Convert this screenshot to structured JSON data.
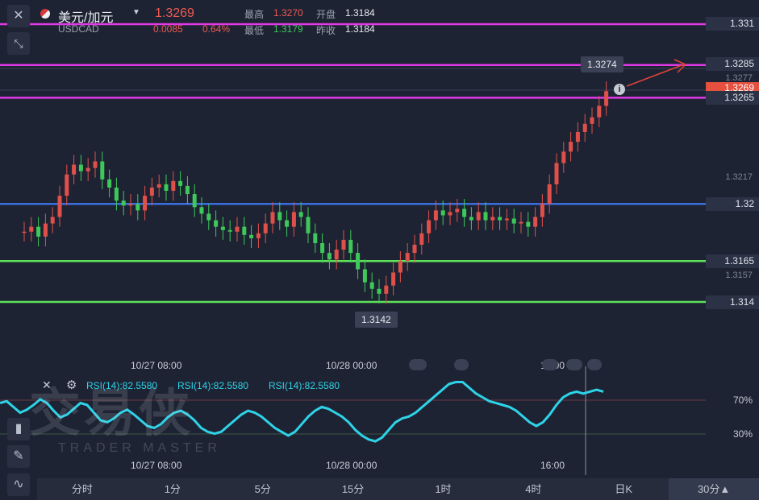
{
  "header": {
    "pair": "美元/加元",
    "code": "USDCAD",
    "price": "1.3269",
    "change": "0.0085",
    "change_pct": "0.64%",
    "high_label": "最高",
    "high": "1.3270",
    "low_label": "最低",
    "low": "1.3179",
    "open_label": "开盘",
    "open": "1.3184",
    "prev_label": "昨收",
    "prev": "1.3184"
  },
  "price_lines": [
    {
      "label": "1.331",
      "value": 1.331,
      "color": "#e13ae6"
    },
    {
      "label": "1.3285",
      "value": 1.3285,
      "color": "#e13ae6"
    },
    {
      "label": "1.3265",
      "value": 1.3265,
      "color": "#e13ae6"
    },
    {
      "label": "1.32",
      "value": 1.32,
      "color": "#3a6fe0"
    },
    {
      "label": "1.3165",
      "value": 1.3165,
      "color": "#5ee25a"
    },
    {
      "label": "1.314",
      "value": 1.314,
      "color": "#5ee25a"
    }
  ],
  "current_price_tag": "1.3269",
  "axis_labels": [
    "1.3277",
    "1.3217",
    "1.3157"
  ],
  "callouts": {
    "high": "1.3274",
    "low": "1.3142"
  },
  "time_labels_top": [
    "10/27 08:00",
    "10/28 00:00",
    "16:00"
  ],
  "time_labels_bottom": [
    "10/27 08:00",
    "10/28 00:00",
    "16:00"
  ],
  "rsi": {
    "labels": [
      "RSI(14):82.5580",
      "RSI(14):82.5580",
      "RSI(14):82.5580"
    ],
    "level_70": "70%",
    "level_30": "30%",
    "values": [
      70,
      72,
      66,
      60,
      63,
      68,
      74,
      70,
      62,
      55,
      58,
      64,
      70,
      68,
      60,
      52,
      50,
      54,
      60,
      63,
      58,
      52,
      46,
      44,
      48,
      55,
      60,
      62,
      58,
      52,
      44,
      40,
      38,
      40,
      46,
      52,
      58,
      62,
      60,
      56,
      50,
      44,
      40,
      36,
      40,
      48,
      56,
      62,
      66,
      64,
      60,
      56,
      50,
      42,
      36,
      32,
      30,
      34,
      42,
      50,
      54,
      56,
      60,
      66,
      72,
      78,
      84,
      90,
      92,
      92,
      86,
      80,
      76,
      72,
      70,
      68,
      66,
      62,
      56,
      50,
      46,
      50,
      58,
      68,
      76,
      80,
      82,
      80,
      82,
      84,
      82
    ]
  },
  "watermark": {
    "main": "交易侠",
    "sub": "TRADER MASTER"
  },
  "tabs": [
    "分时",
    "1分",
    "5分",
    "15分",
    "1时",
    "4时",
    "日K",
    "30分▲"
  ],
  "selected_tab": 7,
  "colors": {
    "up": "#e0504a",
    "down": "#3ec85a",
    "magenta": "#e13ae6",
    "blue": "#3a6fe0",
    "green": "#5ee25a",
    "rsi": "#2ed3e8"
  }
}
